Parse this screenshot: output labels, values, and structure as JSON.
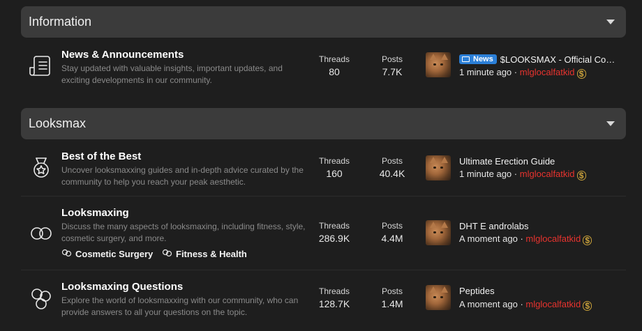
{
  "categories": [
    {
      "title": "Information"
    },
    {
      "title": "Looksmax"
    }
  ],
  "stat_labels": {
    "threads": "Threads",
    "posts": "Posts"
  },
  "nodes": [
    {
      "title": "News & Announcements",
      "description": "Stay updated with valuable insights, important updates, and exciting developments in our community.",
      "icon": "document-icon",
      "threads": "80",
      "posts": "7.7K",
      "latest": {
        "prefix": "News",
        "title": "$LOOKSMAX - Official Com…",
        "time": "1 minute ago",
        "separator": "·",
        "user": "mlglocalfatkid"
      }
    },
    {
      "title": "Best of the Best",
      "description": "Uncover looksmaxxing guides and in-depth advice curated by the community to help you reach your peak aesthetic.",
      "icon": "medal-icon",
      "threads": "160",
      "posts": "40.4K",
      "latest": {
        "title": "Ultimate Erection Guide",
        "time": "1 minute ago",
        "separator": "·",
        "user": "mlglocalfatkid"
      }
    },
    {
      "title": "Looksmaxing",
      "description": "Discuss the many aspects of looksmaxing, including fitness, style, cosmetic surgery, and more.",
      "icon": "linked-circles-icon",
      "threads": "286.9K",
      "posts": "4.4M",
      "subforums": [
        "Cosmetic Surgery",
        "Fitness & Health"
      ],
      "latest": {
        "title": "DHT E androlabs",
        "time": "A moment ago",
        "separator": "·",
        "user": "mlglocalfatkid"
      }
    },
    {
      "title": "Looksmaxing Questions",
      "description": "Explore the world of looksmaxxing with our community, who can provide answers to all your questions on the topic.",
      "icon": "three-circles-icon",
      "threads": "128.7K",
      "posts": "1.4M",
      "latest": {
        "title": "Peptides",
        "time": "A moment ago",
        "separator": "·",
        "user": "mlglocalfatkid"
      }
    }
  ],
  "colors": {
    "background": "#1e1e1e",
    "category_bar": "#3b3b3b",
    "username": "#e8332e",
    "news_badge": "#2b7fd7",
    "currency_badge": "#c9a13a"
  }
}
